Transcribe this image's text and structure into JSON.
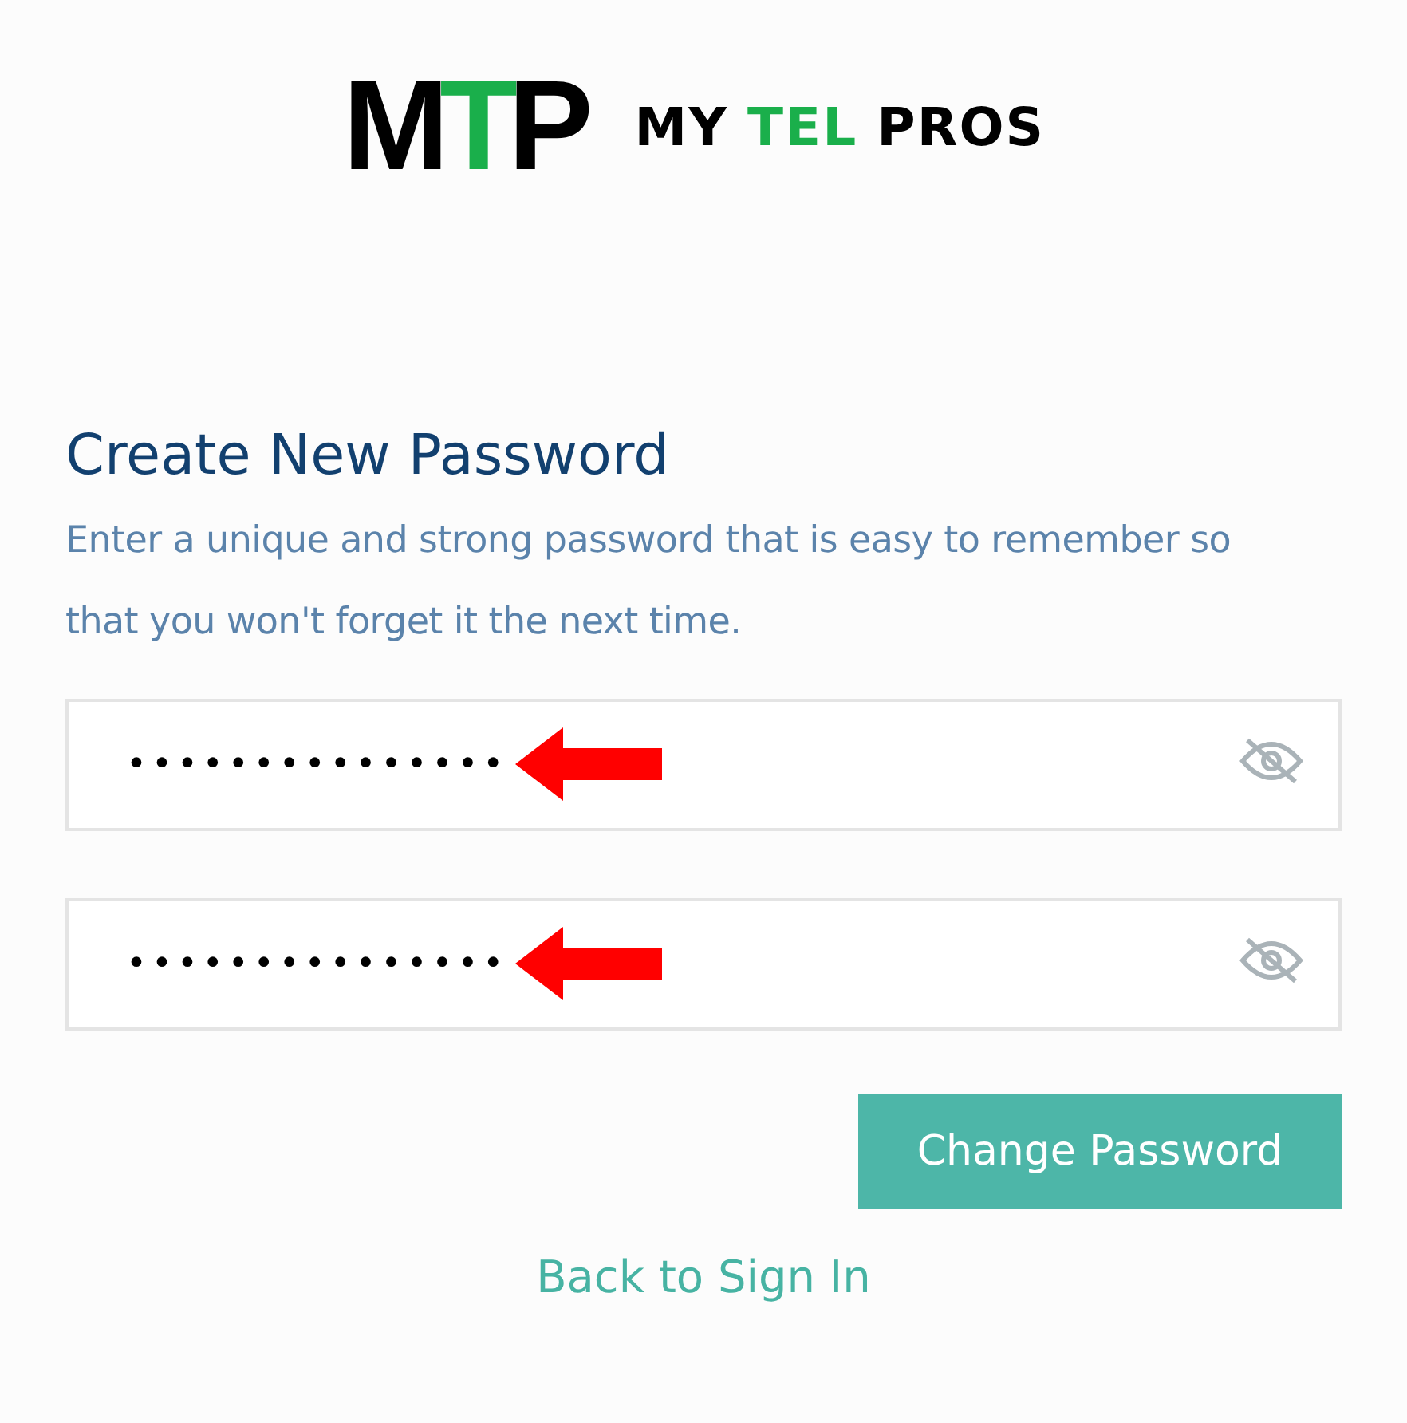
{
  "logo": {
    "mark": [
      {
        "text": "M",
        "color": "#000000"
      },
      {
        "text": "T",
        "color": "#1aaf4b"
      },
      {
        "text": "P",
        "color": "#000000"
      }
    ],
    "wordmark": [
      {
        "text": "MY",
        "color": "#000000"
      },
      {
        "text": "TEL",
        "color": "#1aaf4b"
      },
      {
        "text": "PROS",
        "color": "#000000"
      }
    ]
  },
  "title": "Create New Password",
  "description": "Enter a unique and strong password that is easy to remember so that you won't forget it the next time.",
  "fields": [
    {
      "value": "•••••••••••••••",
      "annotated": true,
      "masked": true
    },
    {
      "value": "•••••••••••••••",
      "annotated": true,
      "masked": true
    }
  ],
  "submit_button": "Change Password",
  "back_link": "Back to Sign In"
}
